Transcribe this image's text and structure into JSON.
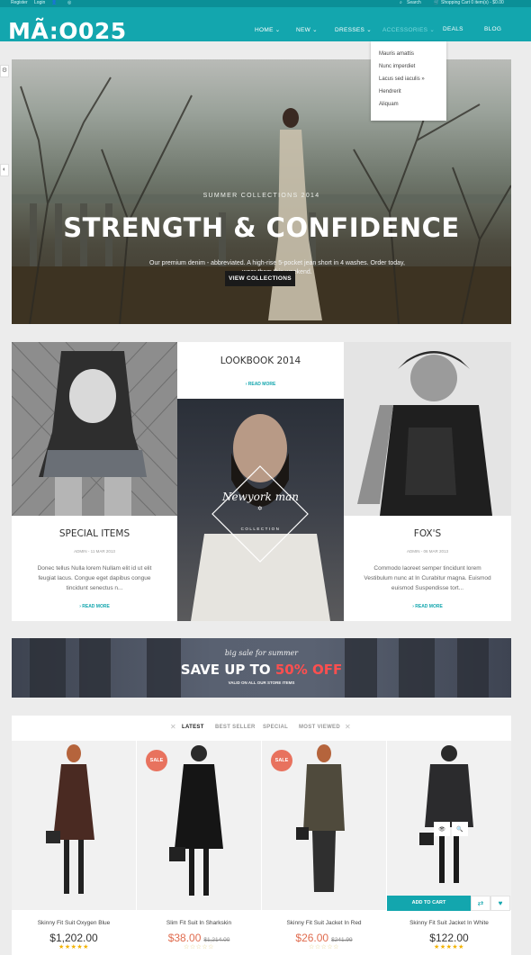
{
  "topbar": {
    "register": "Register",
    "login": "Login",
    "search": "Search",
    "cart": "Shopping Cart 0 item(s) - $0.00"
  },
  "brand": "MÃ:O025",
  "nav": {
    "items": [
      {
        "label": "HOME ⌄"
      },
      {
        "label": "NEW ⌄"
      },
      {
        "label": "DRESSES ⌄"
      },
      {
        "label": "ACCESSORIES ⌄"
      },
      {
        "label": "DEALS"
      },
      {
        "label": "BLOG"
      }
    ],
    "active_index": 3
  },
  "dropdown": {
    "items": [
      "Mauris amattis",
      "Nunc imperdiet",
      "Lacus sed iaculis »",
      "Hendrerit",
      "Aliquam"
    ]
  },
  "side_tabs": [
    "⚙",
    "◐"
  ],
  "hero": {
    "subtitle": "SUMMER COLLECTIONS 2014",
    "headline": "STRENGTH & CONFIDENCE",
    "description": "Our premium denim - abbreviated. A high-rise 5-pocket jean short in 4 washes. Order today, wear them this weekend.",
    "cta": "VIEW COLLECTIONS"
  },
  "features": {
    "left": {
      "title": "SPECIAL ITEMS",
      "meta": "ADMIN - 11 MAR 2013",
      "text": "Donec tellus Nulla lorem Nullam elit id ut elit feugiat lacus. Congue eget dapibus congue tincidunt senectus n...",
      "more": "› READ MORE"
    },
    "center": {
      "title": "LOOKBOOK 2014",
      "more": "› READ MORE",
      "badge_title": "Newyork man",
      "badge_star": "✡",
      "badge_sub": "COLLECTION"
    },
    "right": {
      "title": "FOX'S",
      "meta": "ADMIN - 06 MAR 2013",
      "text": "Commodo laoreet semper tincidunt lorem Vestibulum nunc at In Curabitur magna. Euismod euismod Suspendisse tort...",
      "more": "› READ MORE"
    }
  },
  "banner": {
    "small": "big sale for summer",
    "big_prefix": "SAVE UP TO ",
    "big_highlight": "50% OFF",
    "note": "VALID ON ALL OUR STORE ITEMS"
  },
  "product_tabs": {
    "items": [
      "LATEST",
      "BEST SELLER",
      "SPECIAL",
      "MOST VIEWED"
    ],
    "active_index": 0
  },
  "products": [
    {
      "name": "Skinny Fit Suit Oxygen Blue",
      "price": "$1,202.00",
      "old_price": "",
      "sale": false,
      "rating": "★★★★★"
    },
    {
      "name": "Slim Fit Suit In Sharkskin",
      "price": "$38.00",
      "old_price": "$1,214.00",
      "sale": true,
      "sale_label": "SALE",
      "rating": "☆☆☆☆☆"
    },
    {
      "name": "Skinny Fit Suit Jacket In Red",
      "price": "$26.00",
      "old_price": "$241.99",
      "sale": true,
      "sale_label": "SALE",
      "rating": "☆☆☆☆☆"
    },
    {
      "name": "Skinny Fit Suit Jacket In White",
      "price": "$122.00",
      "old_price": "",
      "sale": false,
      "rating": "★★★★★"
    }
  ],
  "product_actions": {
    "add_to_cart": "ADD TO CART",
    "compare_icon": "⇄",
    "wishlist_icon": "♥",
    "view_icon": "👁",
    "zoom_icon": "🔍"
  },
  "colors": {
    "accent": "#13a6ae",
    "sale": "#e8725e",
    "star": "#f2b200"
  }
}
